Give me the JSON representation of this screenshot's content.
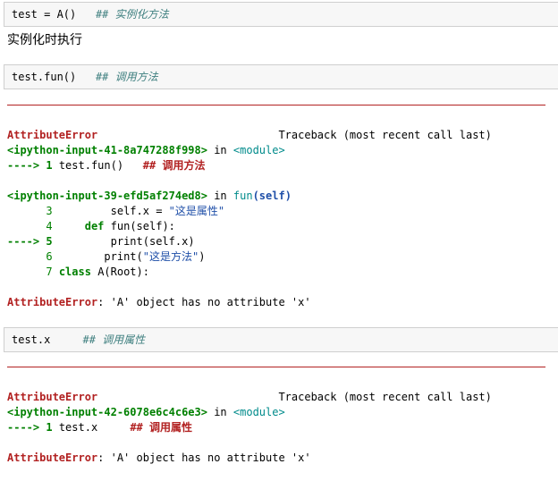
{
  "cells": {
    "c1_code": "test = A()",
    "c1_comment": "## 实例化方法",
    "c1_output": "实例化时执行",
    "c2_code": "test.fun()",
    "c2_comment": "## 调用方法",
    "c3_code": "test.x",
    "c3_comment": "## 调用属性"
  },
  "tb1": {
    "err": "AttributeError",
    "traceback": "Traceback (most recent call last)",
    "frame1_file": "<ipython-input-41-8a747288f998>",
    "in": "in",
    "frame1_func": "<module>",
    "arrow": "---->",
    "frame1_lineno": "1",
    "frame1_code": "test.fun()",
    "frame1_comment": "## 调用方法",
    "frame2_file": "<ipython-input-39-efd5af274ed8>",
    "frame2_func": "fun",
    "frame2_args": "(self)",
    "l3_no": "3",
    "l3_a": "self.x = ",
    "l3_str": "\"这是属性\"",
    "l4_no": "4",
    "l4_kw": "def",
    "l4_rest": "fun(self):",
    "l5_arrow": "---->",
    "l5_no": "5",
    "l5_code": "print(self.x)",
    "l6_no": "6",
    "l6_a": "print(",
    "l6_str": "\"这是方法\"",
    "l6_b": ")",
    "l7_no": "7",
    "l7_kw": "class",
    "l7_rest": "A(Root):",
    "final_err": "AttributeError",
    "final_msg": ": 'A' object has no attribute 'x'"
  },
  "tb2": {
    "err": "AttributeError",
    "traceback": "Traceback (most recent call last)",
    "frame1_file": "<ipython-input-42-6078e6c4c6e3>",
    "in": "in",
    "frame1_func": "<module>",
    "arrow": "---->",
    "frame1_lineno": "1",
    "frame1_code": "test.x",
    "frame1_comment": "## 调用属性",
    "final_err": "AttributeError",
    "final_msg": ": 'A' object has no attribute 'x'"
  }
}
